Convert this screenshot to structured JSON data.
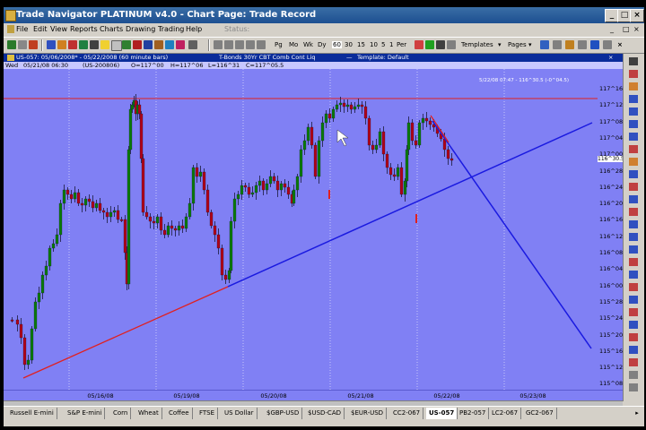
{
  "window": {
    "title": "Trade Navigator PLATINUM v4.0  -  Chart Page: Trade Record",
    "minimize": "_",
    "maximize": "□",
    "close": "×"
  },
  "menu": {
    "items": [
      "File",
      "Edit",
      "View",
      "Reports",
      "Charts",
      "Drawing",
      "Trading",
      "Help"
    ],
    "status": "Status:"
  },
  "toolbar": {
    "periods": [
      "Pg",
      "Mo",
      "Wk",
      "Dy",
      "60",
      "30",
      "15",
      "10",
      "5",
      "1",
      "Per"
    ],
    "templates": "Templates",
    "pages": "Pages"
  },
  "chart_header": {
    "symbol_range": "US-057: 05/06/2008* - 05/22/2008 (60 minute bars)",
    "description": "T-Bonds 30Yr CBT Comb Cont Liq",
    "template": "Template: Default"
  },
  "info_line": {
    "wed_label": "Wed",
    "datetime": "05/21/08 06:30",
    "symbol": "(US-200806)",
    "open": "O=117^00",
    "high": "H=117^06",
    "low": "L=116^31",
    "close": "C=117^05.5"
  },
  "date_readout": "5/22/08 07:47 - 116^30.5 (-0^04.5)",
  "y_axis": {
    "labels": [
      "117^16",
      "117^12",
      "117^08",
      "117^04",
      "117^00",
      "116^28",
      "116^24",
      "116^20",
      "116^16",
      "116^12",
      "116^08",
      "116^04",
      "116^00",
      "115^28",
      "115^24",
      "115^20",
      "115^16",
      "115^12",
      "115^08"
    ],
    "current_tag": "116^30.5"
  },
  "x_axis": {
    "labels": [
      "05/16/08",
      "05/19/08",
      "05/20/08",
      "05/21/08",
      "05/22/08",
      "05/23/08"
    ]
  },
  "chart_data": {
    "type": "candlestick",
    "title": "US-057: 05/06/2008* - 05/22/2008 (60 minute bars)",
    "ylim": [
      "115^06",
      "117^18"
    ],
    "drawings": {
      "support_line_red": "from ~115^10 (05/15) to ~116^01 (05/19)",
      "support_line_blue": "from ~116^01 (05/19) to ~117^10 (05/23)",
      "projection_line_blue": "from ~117^10 (05/22) down to ~115^17",
      "horizontal_red": "~117^14"
    }
  },
  "colors": {
    "plot_bg": "#8080f4",
    "up_candle": "#0a7a0a",
    "down_candle": "#b00018",
    "trendline_blue": "#1a1ae0",
    "trendline_red": "#e02020"
  },
  "tabs": [
    "Russell E-mini",
    "S&P E-mini",
    "Corn",
    "Wheat",
    "Coffee",
    "FTSE",
    "US Dollar",
    "$GBP-USD",
    "$USD-CAD",
    "$EUR-USD",
    "CC2-067",
    "US-057",
    "PB2-057",
    "LC2-067",
    "GC2-067"
  ],
  "active_tab": "US-057"
}
